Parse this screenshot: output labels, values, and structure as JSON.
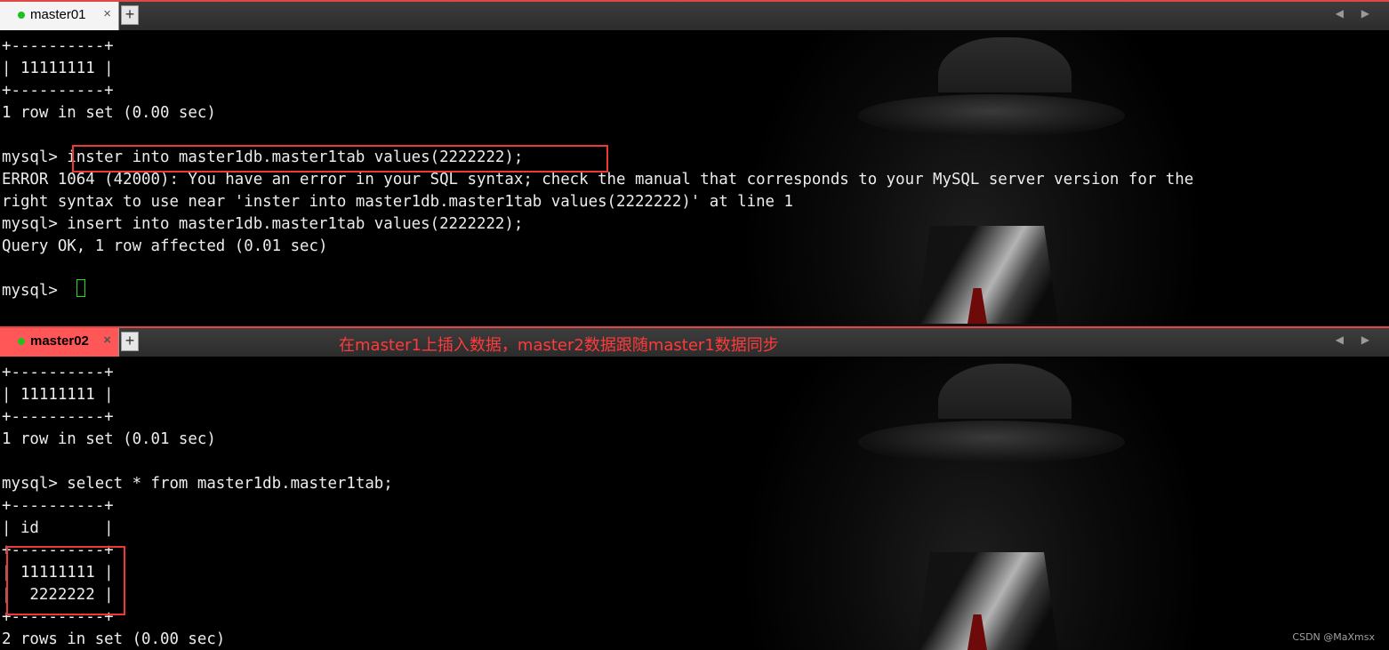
{
  "top_pane": {
    "tab": {
      "label": "master01",
      "close": "×",
      "new_tab": "+"
    },
    "lines": [
      "+----------+",
      "| 11111111 |",
      "+----------+",
      "1 row in set (0.00 sec)",
      "",
      "mysql> inster into master1db.master1tab values(2222222);",
      "ERROR 1064 (42000): You have an error in your SQL syntax; check the manual that corresponds to your MySQL server version for the",
      "right syntax to use near 'inster into master1db.master1tab values(2222222)' at line 1",
      "mysql> insert into master1db.master1tab values(2222222);",
      "Query OK, 1 row affected (0.01 sec)",
      "",
      "mysql> "
    ]
  },
  "bottom_pane": {
    "tab": {
      "label": "master02",
      "close": "×",
      "new_tab": "+"
    },
    "annotation": "在master1上插入数据，master2数据跟随master1数据同步",
    "lines": [
      "+----------+",
      "| 11111111 |",
      "+----------+",
      "1 row in set (0.01 sec)",
      "",
      "mysql> select * from master1db.master1tab;",
      "+----------+",
      "| id       |",
      "+----------+",
      "| 11111111 |",
      "|  2222222 |",
      "+----------+",
      "2 rows in set (0.00 sec)"
    ]
  },
  "tab_scroll_arrows": "◀ ▶",
  "watermark": "CSDN @MaXmsx",
  "colors": {
    "tab_active": "#ff5757",
    "tab_accent": "#e04848",
    "highlight_box": "#ee3838",
    "annotation_text": "#ff3a3a",
    "cursor": "#22dd22",
    "terminal_text": "#ececec",
    "terminal_bg": "#000000"
  }
}
